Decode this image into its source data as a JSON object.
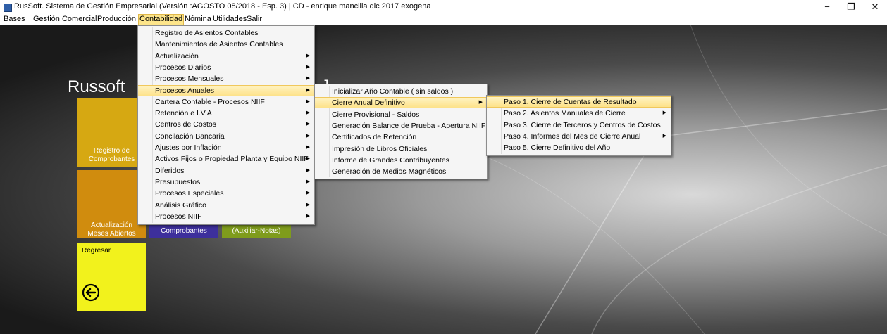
{
  "window": {
    "title": "RusSoft. Sistema de Gestión Empresarial (Versión :AGOSTO 08/2018 - Esp. 3) | CD - enrique mancilla dic 2017 exogena",
    "minimize": "−",
    "maximize": "❐",
    "close": "✕"
  },
  "menubar": {
    "items": [
      "Bases",
      "Gestión Comercial",
      "Producción",
      "Contabilidad",
      "Nómina",
      "Utilidades",
      "Salir"
    ],
    "active": "Contabilidad"
  },
  "main": {
    "title_left": "Russoft",
    "title_right": ". ]",
    "tiles": {
      "registro": "Registro de\nComprobantes",
      "actualizacion": "Actualización\nMeses Abiertos",
      "comprobantes": "Comprobantes",
      "auxiliar": "(Auxiliar-Notas)",
      "regresar": "Regresar"
    }
  },
  "contabilidad_menu": [
    {
      "label": "Registro de Asientos Contables",
      "sub": false
    },
    {
      "label": "Mantenimientos de Asientos Contables",
      "sub": false
    },
    {
      "label": "Actualización",
      "sub": true
    },
    {
      "label": "Procesos Diarios",
      "sub": true
    },
    {
      "label": "Procesos Mensuales",
      "sub": true
    },
    {
      "label": "Procesos Anuales",
      "sub": true
    },
    {
      "label": "Cartera Contable - Procesos NIIF",
      "sub": true
    },
    {
      "label": "Retención e I.V.A",
      "sub": true
    },
    {
      "label": "Centros de Costos",
      "sub": true
    },
    {
      "label": "Concilación Bancaria",
      "sub": true
    },
    {
      "label": "Ajustes por Inflación",
      "sub": true
    },
    {
      "label": "Activos Fijos o Propiedad Planta y Equipo NIIF",
      "sub": true
    },
    {
      "label": "Diferidos",
      "sub": true
    },
    {
      "label": "Presupuestos",
      "sub": true
    },
    {
      "label": "Procesos Especiales",
      "sub": true
    },
    {
      "label": "Análisis Gráfico",
      "sub": true
    },
    {
      "label": "Procesos NIIF",
      "sub": true
    }
  ],
  "anuales_menu": [
    {
      "label": "Inicializar Año Contable ( sin saldos )",
      "sub": false
    },
    {
      "label": "Cierre Anual Definitivo",
      "sub": true
    },
    {
      "label": "Cierre Provisional - Saldos",
      "sub": false
    },
    {
      "label": "Generación Balance de Prueba - Apertura NIIF",
      "sub": false
    },
    {
      "label": "Certificados de Retención",
      "sub": false
    },
    {
      "label": "Impresión de Libros Oficiales",
      "sub": false
    },
    {
      "label": "Informe de Grandes Contribuyentes",
      "sub": false
    },
    {
      "label": "Generación de Medios Magnéticos",
      "sub": false
    }
  ],
  "cierre_menu": [
    {
      "label": "Paso 1. Cierre de Cuentas de Resultado",
      "sub": false
    },
    {
      "label": "Paso 2. Asientos Manuales de Cierre",
      "sub": true
    },
    {
      "label": "Paso 3. Cierre de Terceros y Centros de Costos",
      "sub": false
    },
    {
      "label": "Paso 4. Informes del Mes de Cierre Anual",
      "sub": true
    },
    {
      "label": "Paso 5. Cierre Definitivo del Año",
      "sub": false
    }
  ],
  "colors": {
    "tile_registro": "#d6a812",
    "tile_actualizacion": "#d08c0e",
    "tile_comprobantes": "#3d2f9c",
    "tile_auxiliar": "#7f9c1c",
    "tile_regresar": "#f2f21c",
    "highlight": "#fde28a"
  }
}
